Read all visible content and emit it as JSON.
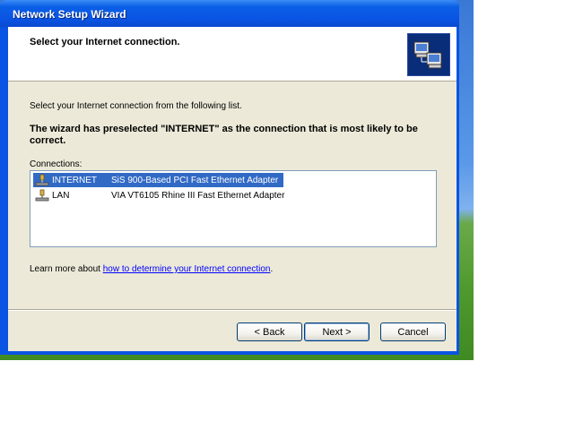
{
  "window": {
    "title": "Network Setup Wizard"
  },
  "header": {
    "title": "Select your Internet connection.",
    "icon": "network-computers-icon"
  },
  "content": {
    "intro": "Select your Internet connection from the following list.",
    "preselect_message": "The wizard has preselected \"INTERNET\" as the connection that is most likely to be correct.",
    "connections_label": "Connections:",
    "connections": [
      {
        "name": "INTERNET",
        "adapter": "SiS 900-Based PCI Fast Ethernet Adapter",
        "selected": true,
        "icon": "network-connection-icon"
      },
      {
        "name": "LAN",
        "adapter": "VIA VT6105 Rhine III Fast Ethernet Adapter",
        "selected": false,
        "icon": "network-connection-icon"
      }
    ],
    "learn_prefix": "Learn more about ",
    "learn_link": "how to determine your Internet connection",
    "learn_suffix": "."
  },
  "buttons": {
    "back": "< Back",
    "next": "Next >",
    "cancel": "Cancel"
  },
  "colors": {
    "title_bar": "#0a54e3",
    "selection": "#316ac5",
    "dialog_bg": "#ece9d8"
  }
}
